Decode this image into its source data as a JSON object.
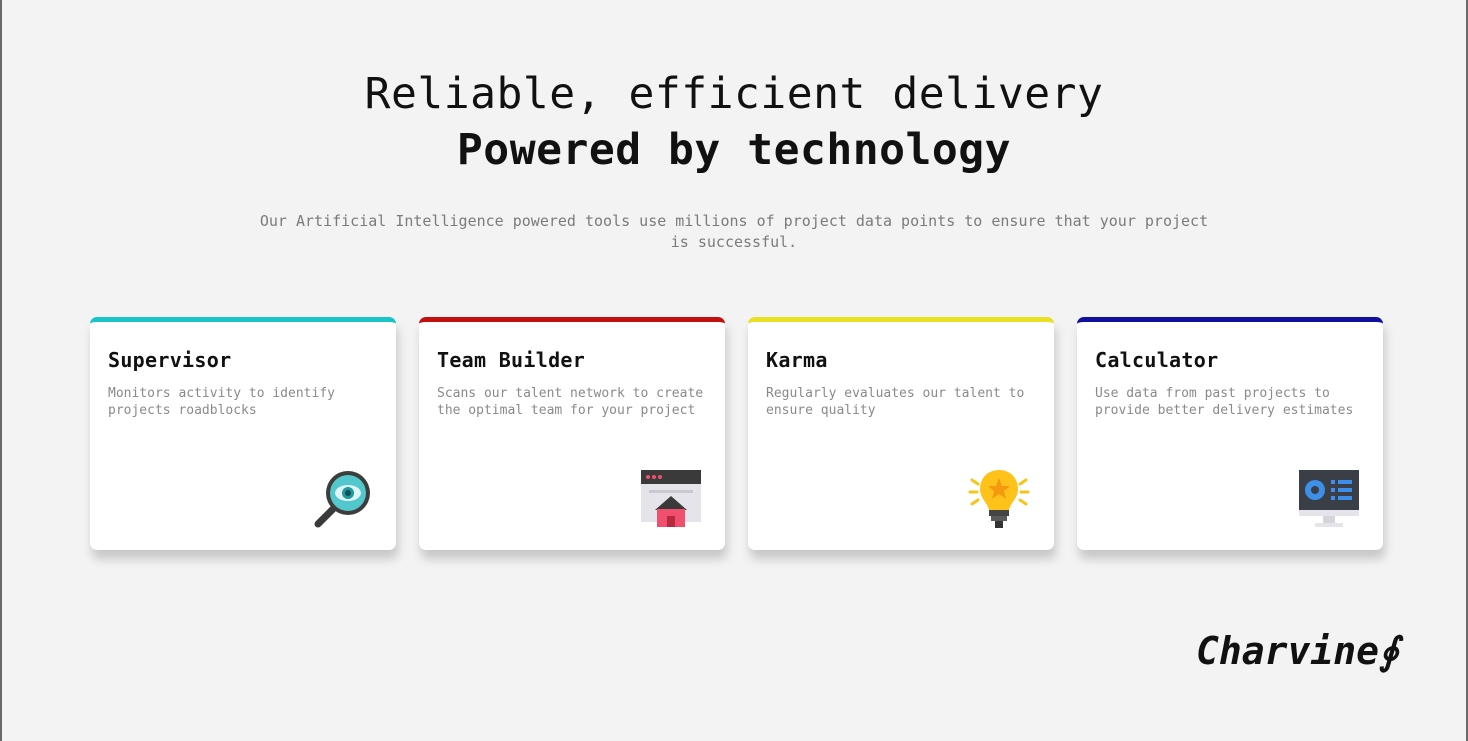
{
  "hero": {
    "title_line1": "Reliable, efficient delivery",
    "title_line2": "Powered by technology",
    "subtitle": "Our Artificial Intelligence powered tools use millions of project data points to ensure that your project is successful."
  },
  "cards": [
    {
      "title": "Supervisor",
      "description": "Monitors activity to identify projects roadblocks",
      "accent": "#19c3c7",
      "icon": "magnifier-eye-icon"
    },
    {
      "title": "Team Builder",
      "description": "Scans our talent network to create the optimal team for your project",
      "accent": "#c21010",
      "icon": "browser-home-icon"
    },
    {
      "title": "Karma",
      "description": "Regularly evaluates our talent to ensure quality",
      "accent": "#e8e022",
      "icon": "lightbulb-icon"
    },
    {
      "title": "Calculator",
      "description": "Use data from past projects to provide better delivery estimates",
      "accent": "#10109c",
      "icon": "monitor-dashboard-icon"
    }
  ],
  "brand": {
    "logo_text": "Charvine∮"
  },
  "colors": {
    "background": "#f3f3f3",
    "subtitle": "#7b7b7b",
    "card_text": "#8a8a8a"
  }
}
